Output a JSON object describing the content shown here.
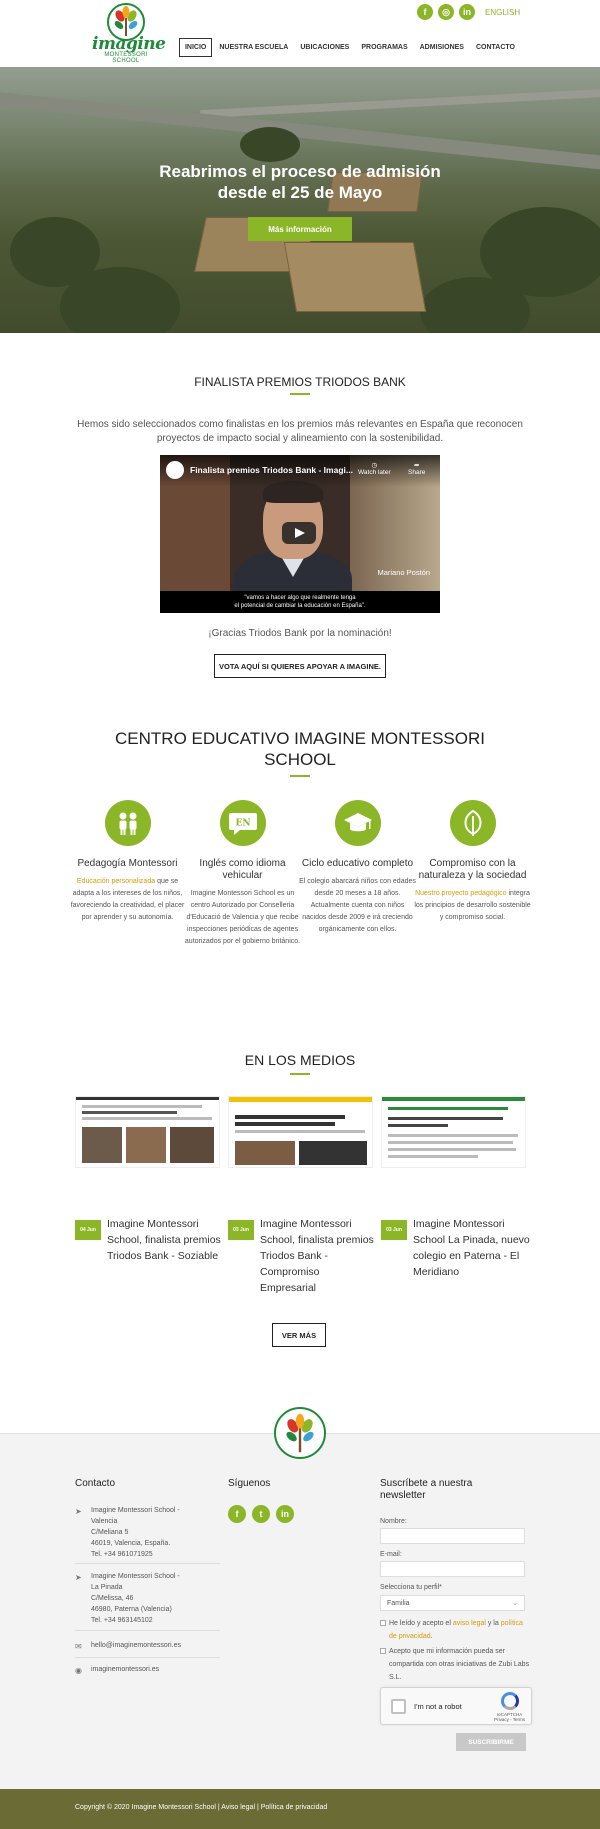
{
  "header": {
    "logo_brand": "imagine",
    "logo_sub": "MONTESSORI SCHOOL",
    "social": [
      {
        "icon": "facebook-icon",
        "glyph": "f"
      },
      {
        "icon": "instagram-icon",
        "glyph": "◎"
      },
      {
        "icon": "linkedin-icon",
        "glyph": "in"
      }
    ],
    "language": "ENGLISH",
    "nav": [
      "INICIO",
      "NUESTRA ESCUELA",
      "UBICACIONES",
      "PROGRAMAS",
      "ADMISIONES",
      "CONTACTO"
    ],
    "active_nav": "INICIO"
  },
  "hero": {
    "title_line1": "Reabrimos el proceso de admisión",
    "title_line2": "desde el 25 de Mayo",
    "button": "Más información"
  },
  "triodos": {
    "heading": "FINALISTA PREMIOS TRIODOS BANK",
    "lead": "Hemos sido seleccionados como finalistas en los premios más relevantes en España que reconocen proyectos de impacto social y alineamiento con la sostenibilidad.",
    "video": {
      "title": "Finalista premios Triodos Bank - Imagi...",
      "watch_later": "Watch later",
      "share": "Share",
      "person": "Mariano Postón",
      "subtitle_line1": "\"vamos a hacer algo que realmente tenga",
      "subtitle_line2": "el potencial de cambiar la educación en España\"."
    },
    "thanks": "¡Gracias Triodos Bank por la nominación!",
    "vote_button": "VOTA AQUÍ SI QUIERES APOYAR A IMAGINE."
  },
  "centro": {
    "heading_line1": "CENTRO EDUCATIVO IMAGINE MONTESSORI",
    "heading_line2": "SCHOOL",
    "features": [
      {
        "icon": "children-icon",
        "title": "Pedagogía Montessori",
        "highlight": "Educación personalizada",
        "desc": " que se adapta a los intereses de los niños, favoreciendo la creatividad, el placer por aprender y su autonomía.",
        "desc_after": ""
      },
      {
        "icon": "en-speech-bubble-icon",
        "title": "Inglés como idioma vehicular",
        "highlight": "",
        "desc": "Imagine Montessori School es un centro Autorizado por Conselleria d'Educació de Valencia y que recibe inspecciones periódicas de agentes autorizados por el gobierno británico.",
        "desc_after": ""
      },
      {
        "icon": "graduation-cap-icon",
        "title": "Ciclo educativo completo",
        "highlight": "",
        "desc": "El colegio abarcará niños con edades desde 20 meses a 18 años. Actualmente cuenta con niños nacidos desde 2009 e irá creciendo orgánicamente con ellos.",
        "desc_after": ""
      },
      {
        "icon": "leaf-icon",
        "title": "Compromiso con la naturaleza y la sociedad",
        "highlight": "Nuestro proyecto pedagógico",
        "desc": " integra los principios de desarrollo sostenible y compromiso social.",
        "desc_after": ""
      }
    ]
  },
  "medios": {
    "heading": "EN LOS MEDIOS",
    "cards": [
      {
        "date": "04 Jun",
        "title": "Imagine Montessori School, finalista premios Triodos Bank - Soziable"
      },
      {
        "date": "03 Jun",
        "title": "Imagine Montessori School, finalista premios Triodos Bank - Compromiso Empresarial"
      },
      {
        "date": "03 Jun",
        "title": "Imagine Montessori School La Pinada, nuevo colegio en Paterna - El Meridiano"
      }
    ],
    "more_button": "VER MÁS"
  },
  "footer": {
    "contacto": {
      "heading": "Contacto",
      "address1": [
        "Imagine Montessori School -",
        "Valencia",
        "C/Meliana 5",
        "46019, Valencia, España.",
        "Tel. +34 961071925"
      ],
      "address2": [
        "Imagine Montessori School -",
        "La Pinada",
        "C/Melissa, 46",
        "46980, Paterna (Valencia)",
        "Tel. +34 963145102"
      ],
      "email": "hello@imaginemontessori.es",
      "web": "imaginemontessori.es"
    },
    "siguenos": {
      "heading": "Síguenos",
      "social": [
        {
          "icon": "facebook-icon",
          "glyph": "f"
        },
        {
          "icon": "twitter-icon",
          "glyph": "t"
        },
        {
          "icon": "linkedin-icon",
          "glyph": "in"
        }
      ]
    },
    "newsletter": {
      "heading_line1": "Suscríbete a nuestra",
      "heading_line2": "newsletter",
      "name_label": "Nombre:",
      "email_label": "E-mail:",
      "profile_label": "Selecciona tu perfil*",
      "profile_value": "Familia",
      "privacy_text": "He leído y acepto el ",
      "privacy_link1": "aviso legal",
      "privacy_mid": " y la ",
      "privacy_link2": "política de privacidad",
      "privacy_end": ".",
      "share_text": "Acepto que mi información pueda ser compartida con otras iniciativas de Zubi Labs S.L.",
      "captcha_label": "I'm not a robot",
      "captcha_brand": "reCAPTCHA",
      "captcha_links": "Privacy - Terms",
      "submit": "SUSCRIBIRME"
    },
    "copyright": "Copyright © 2020 Imagine Montessori School | Aviso legal | Política de privacidad"
  }
}
